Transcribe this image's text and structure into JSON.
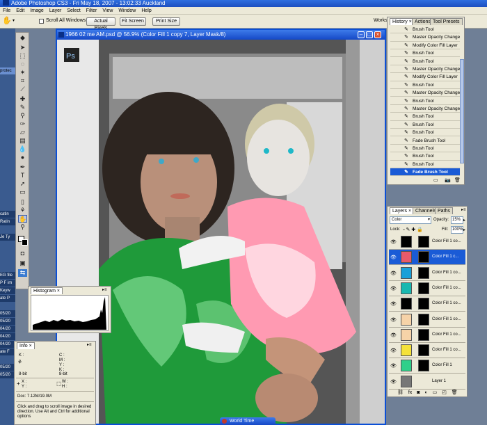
{
  "app": {
    "title": "Adobe Photoshop CS3 - Fri May 18, 2007 - 13:02:33 Auckland",
    "menu": [
      "File",
      "Edit",
      "Image",
      "Layer",
      "Select",
      "Filter",
      "View",
      "Window",
      "Help"
    ]
  },
  "options_bar": {
    "scroll_all_windows": "Scroll All Windows",
    "actual_pixels": "Actual Pixels",
    "fit_screen": "Fit Screen",
    "print_size": "Print Size",
    "workspace": "Workspace"
  },
  "document": {
    "title": "1966 02 me AM.psd @ 56.9% (Color Fill 1 copy 7, Layer Mask/8)",
    "ps_label": "Ps"
  },
  "desktop_labels": [
    "protec",
    "catin",
    "Ratin",
    "Je Ty",
    "EG file",
    "P F im",
    "Keyw",
    "ate P",
    "05/20",
    "05/20",
    "04/20",
    "04/20",
    "04/20",
    "ate F",
    "05/20",
    "05/20"
  ],
  "histogram": {
    "tab": "Histogram"
  },
  "info": {
    "tab": "Info",
    "k_label": "K :",
    "cmyk_labels": [
      "C :",
      "M :",
      "Y :",
      "K :"
    ],
    "bit1": "8-bit",
    "bit2": "8-bit",
    "xy": [
      "X :",
      "Y :"
    ],
    "wh": [
      "W :",
      "H :"
    ],
    "doc": "Doc: 7.12M/19.0M",
    "hint": "Click and drag to scroll image in desired direction. Use Alt and Ctrl for additional options"
  },
  "history": {
    "tabs": [
      "History",
      "Actions",
      "Tool Presets"
    ],
    "items": [
      "Brush Tool",
      "Master Opacity Change",
      "Modify Color Fill Layer",
      "Brush Tool",
      "Brush Tool",
      "Master Opacity Change",
      "Modify Color Fill Layer",
      "Brush Tool",
      "Master Opacity Change",
      "Brush Tool",
      "Master Opacity Change",
      "Brush Tool",
      "Brush Tool",
      "Brush Tool",
      "Fade Brush Tool",
      "Brush Tool",
      "Brush Tool",
      "Brush Tool",
      "Fade Brush Tool"
    ],
    "selected_index": 18
  },
  "layers": {
    "tabs": [
      "Layers",
      "Channels",
      "Paths"
    ],
    "blend_mode": "Color",
    "opacity_label": "Opacity:",
    "opacity": "15%",
    "lock_label": "Lock:",
    "fill_label": "Fill:",
    "fill": "100%",
    "rows": [
      {
        "name": "Color Fill 1 co...",
        "color": "#000000"
      },
      {
        "name": "Color Fill 1 c...",
        "color": "#e85a6a"
      },
      {
        "name": "Color Fill 1 co...",
        "color": "#1aa0d8"
      },
      {
        "name": "Color Fill 1 co...",
        "color": "#19b8b0"
      },
      {
        "name": "Color Fill 1 co...",
        "color": "#000000"
      },
      {
        "name": "Color Fill 1 co...",
        "color": "#f6d3a8"
      },
      {
        "name": "Color Fill 1 co...",
        "color": "#f6d3a8"
      },
      {
        "name": "Color Fill 1 co...",
        "color": "#f5e23a"
      },
      {
        "name": "Color Fill 1",
        "color": "#2fd08a"
      },
      {
        "name": "Layer 1",
        "color": "#777777"
      }
    ],
    "selected_index": 1
  },
  "taskbar": {
    "world_time": "World Time"
  },
  "colors": {
    "xp_blue": "#1548c6",
    "selection": "#1a5bd6",
    "panel_bg": "#ece9d8"
  }
}
